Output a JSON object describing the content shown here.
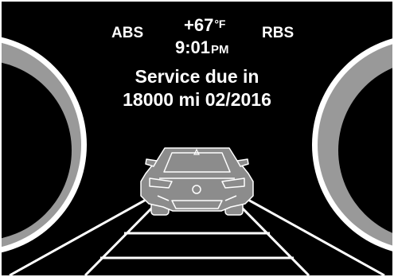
{
  "status": {
    "abs_label": "ABS",
    "rbs_label": "RBS",
    "temperature": "+67",
    "temperature_unit": "°F",
    "time": "9:01",
    "time_suffix": "PM"
  },
  "service": {
    "line1": "Service due in",
    "line2": "18000 mi 02/2016"
  },
  "icons": {
    "left_gauge": "left-gauge-dial-icon",
    "right_gauge": "right-gauge-dial-icon",
    "vehicle": "car-rear-view-icon",
    "road": "road-lanes-icon"
  },
  "colors": {
    "background": "#000000",
    "text": "#ffffff",
    "gauge_ring": "#999999",
    "car_body": "#8c8c8c"
  }
}
